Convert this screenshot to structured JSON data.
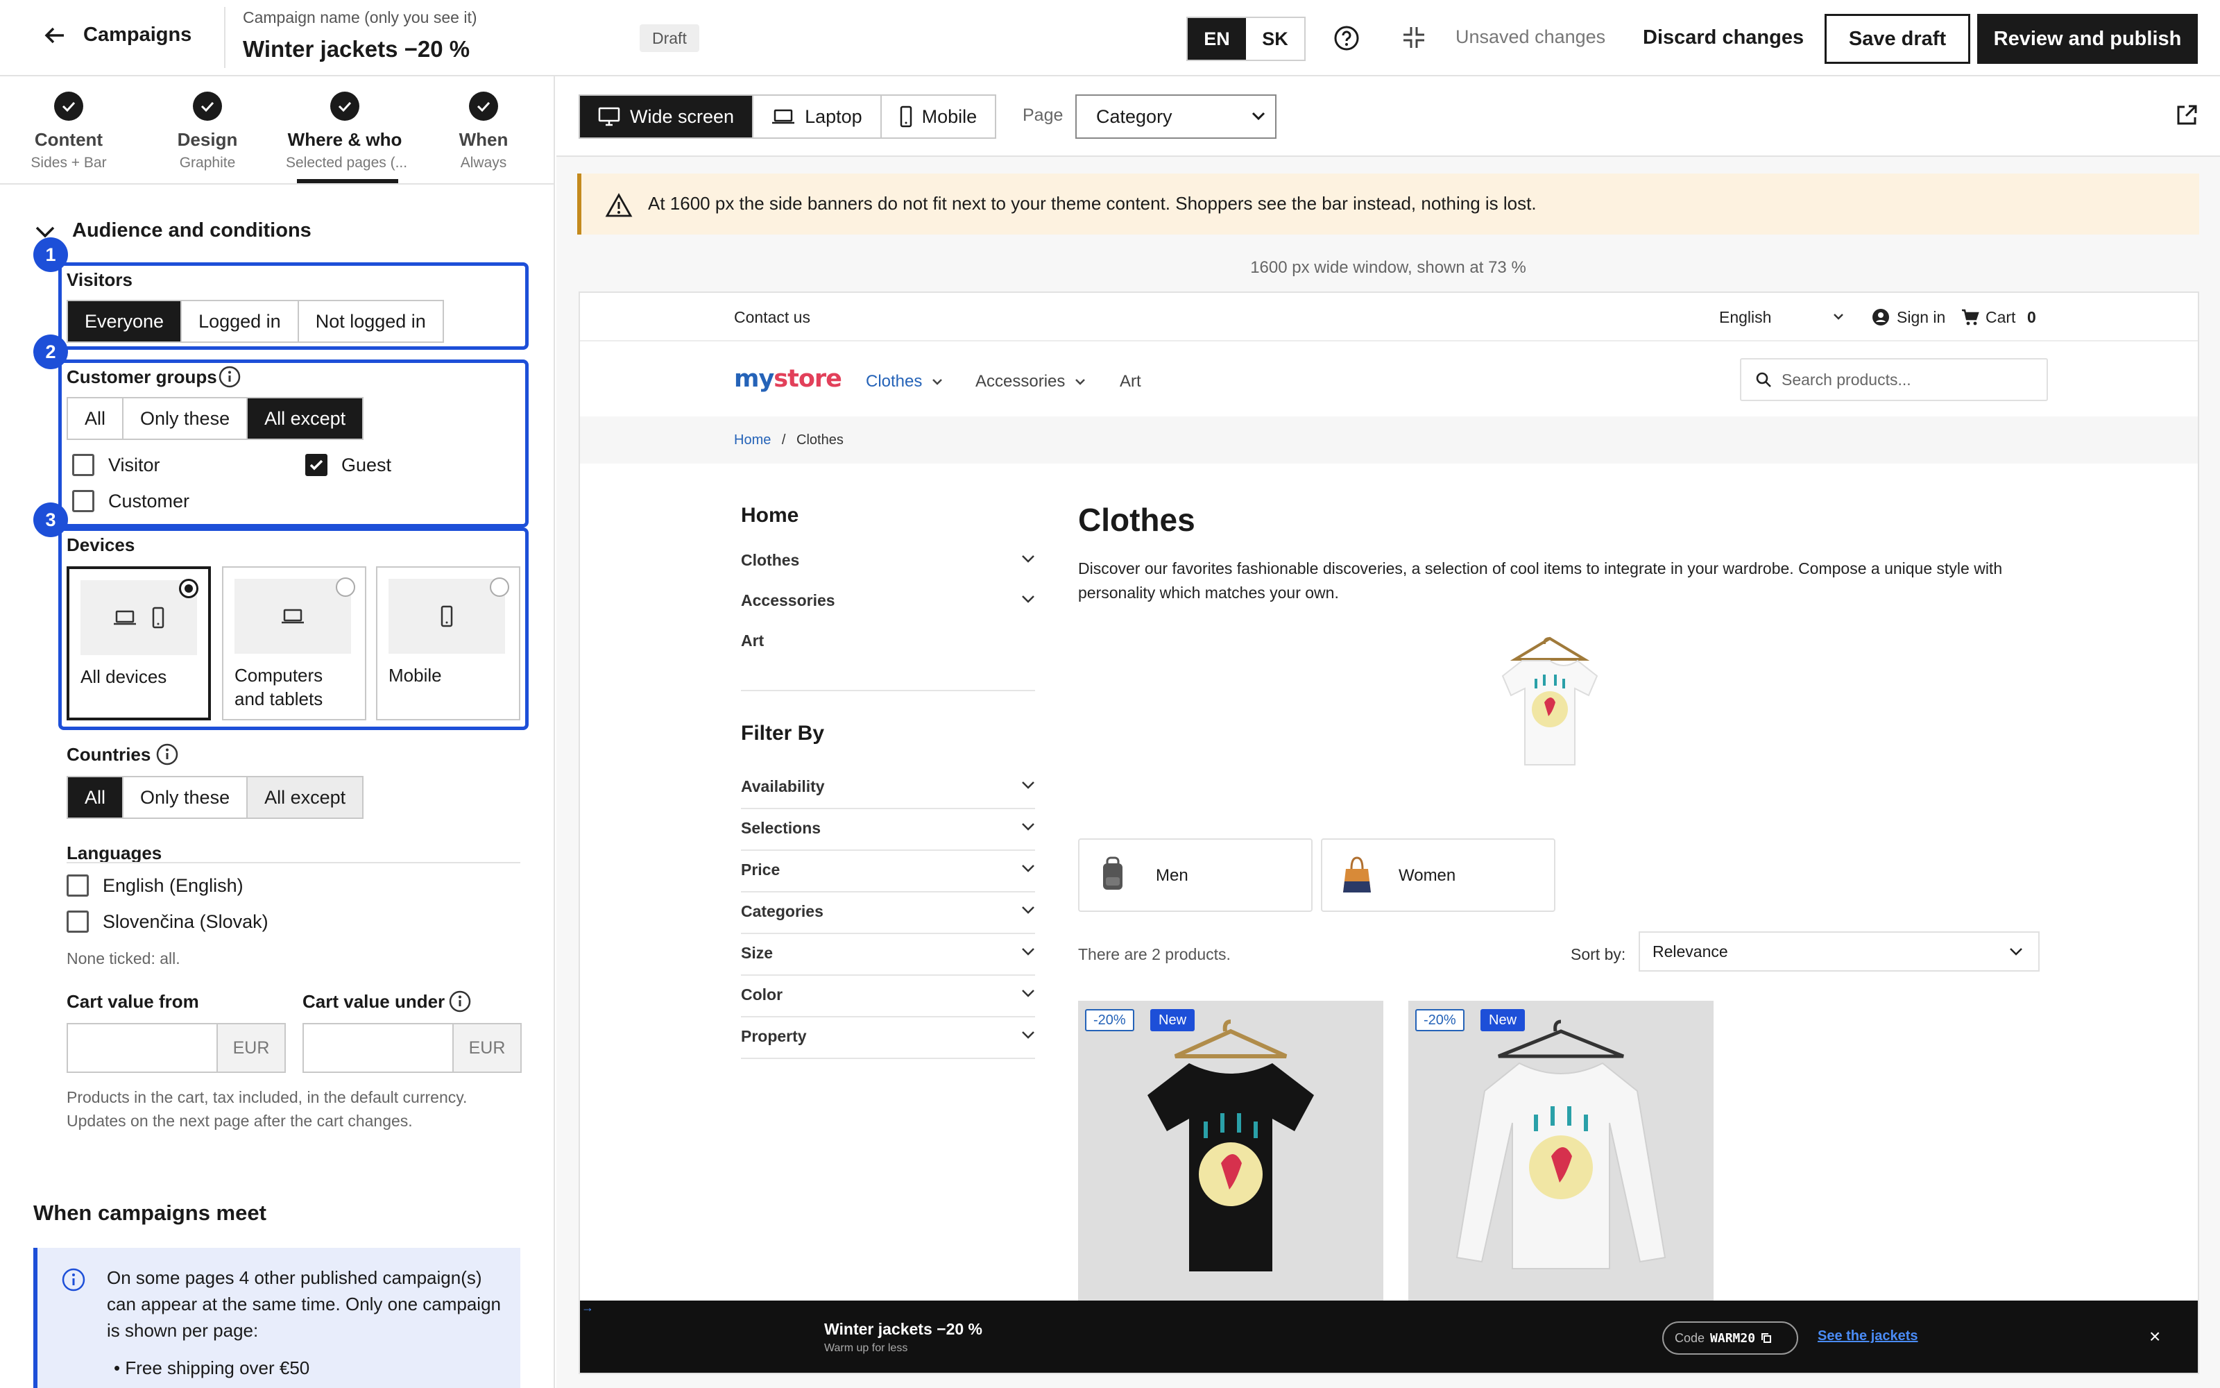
{
  "topbar": {
    "back_label": "Campaigns",
    "campaign_name_label": "Campaign name (only you see it)",
    "campaign_name": "Winter jackets −20 %",
    "status": "Draft",
    "languages": [
      "EN",
      "SK"
    ],
    "active_language": "EN",
    "unsaved": "Unsaved changes",
    "discard": "Discard changes",
    "save_draft": "Save draft",
    "publish": "Review and publish"
  },
  "steps": [
    {
      "title": "Content",
      "sub": "Sides + Bar"
    },
    {
      "title": "Design",
      "sub": "Graphite"
    },
    {
      "title": "Where & who",
      "sub": "Selected pages (..."
    },
    {
      "title": "When",
      "sub": "Always"
    }
  ],
  "audience": {
    "section_title": "Audience and conditions",
    "badges": [
      "1",
      "2",
      "3"
    ],
    "visitors": {
      "label": "Visitors",
      "options": [
        "Everyone",
        "Logged in",
        "Not logged in"
      ],
      "selected": "Everyone"
    },
    "groups": {
      "label": "Customer groups",
      "options": [
        "All",
        "Only these",
        "All except"
      ],
      "selected": "All except",
      "checkboxes": [
        {
          "label": "Visitor",
          "checked": false
        },
        {
          "label": "Guest",
          "checked": true
        },
        {
          "label": "Customer",
          "checked": false
        }
      ]
    },
    "devices": {
      "label": "Devices",
      "options": [
        "All devices",
        "Computers and tablets",
        "Mobile"
      ],
      "selected": "All devices"
    },
    "countries": {
      "label": "Countries",
      "options": [
        "All",
        "Only these",
        "All except"
      ],
      "selected": "All"
    },
    "languages": {
      "label": "Languages",
      "options": [
        "English (English)",
        "Slovenčina (Slovak)"
      ],
      "hint": "None ticked: all."
    },
    "cart": {
      "from_label": "Cart value from",
      "under_label": "Cart value under",
      "currency": "EUR",
      "hint_line1": "Products in the cart, tax included, in the default currency.",
      "hint_line2": "Updates on the next page after the cart changes."
    }
  },
  "meet": {
    "title": "When campaigns meet",
    "info": "On some pages 4 other published campaign(s) can appear at the same time. Only one campaign is shown per page:",
    "bullet": "Free shipping over €50"
  },
  "preview": {
    "views": [
      "Wide screen",
      "Laptop",
      "Mobile"
    ],
    "active_view": "Wide screen",
    "page_label": "Page",
    "page_value": "Category",
    "warning": "At 1600 px the side banners do not fit next to your theme content. Shoppers see the bar instead, nothing is lost.",
    "scale_note": "1600 px wide window, shown at 73 %"
  },
  "store": {
    "contact": "Contact us",
    "language": "English",
    "sign_in": "Sign in",
    "cart": "Cart",
    "cart_count": "0",
    "logo_a": "my",
    "logo_b": "store",
    "nav": [
      "Clothes",
      "Accessories",
      "Art"
    ],
    "search_placeholder": "Search products...",
    "breadcrumb_home": "Home",
    "breadcrumb_sep": "/",
    "breadcrumb_current": "Clothes",
    "sidebar_home": "Home",
    "sidebar_cats": [
      "Clothes",
      "Accessories",
      "Art"
    ],
    "filter_title": "Filter By",
    "filters": [
      "Availability",
      "Selections",
      "Price",
      "Categories",
      "Size",
      "Color",
      "Property"
    ],
    "title": "Clothes",
    "description": "Discover our favorites fashionable discoveries, a selection of cool items to integrate in your wardrobe. Compose a unique style with personality which matches your own.",
    "subcats": [
      "Men",
      "Women"
    ],
    "product_count": "There are 2 products.",
    "sort_label": "Sort by:",
    "sort_value": "Relevance",
    "products": [
      {
        "discount": "-20%",
        "badge": "New",
        "color": "#111111"
      },
      {
        "discount": "-20%",
        "badge": "New",
        "color": "#f4f4f4"
      }
    ]
  },
  "bar": {
    "title": "Winter jackets −20 %",
    "subtitle": "Warm up for less",
    "code_label": "Code",
    "code": "WARM20",
    "link": "See the jackets",
    "close": "×"
  },
  "colors": {
    "accent": "#1d4fd8",
    "dark": "#1a1a1a",
    "warning_bg": "#fdf2e0"
  }
}
